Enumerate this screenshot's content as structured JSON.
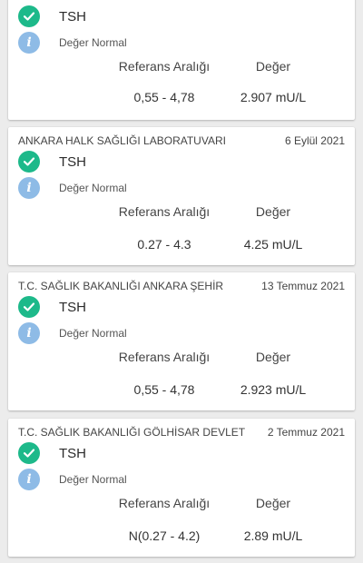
{
  "results": [
    {
      "lab": "",
      "date": "",
      "test": "TSH",
      "status": "Değer Normal",
      "range_label": "Referans Aralığı",
      "value_label": "Değer",
      "range": "0,55 - 4,78",
      "value": "2.907 mU/L"
    },
    {
      "lab": "ANKARA HALK SAĞLIĞI LABORATUVARI",
      "date": "6 Eylül 2021",
      "test": "TSH",
      "status": "Değer Normal",
      "range_label": "Referans Aralığı",
      "value_label": "Değer",
      "range": "0.27 - 4.3",
      "value": "4.25 mU/L"
    },
    {
      "lab": "T.C. SAĞLIK BAKANLIĞI ANKARA ŞEHİR",
      "date": "13 Temmuz 2021",
      "test": "TSH",
      "status": "Değer Normal",
      "range_label": "Referans Aralığı",
      "value_label": "Değer",
      "range": "0,55 - 4,78",
      "value": "2.923 mU/L"
    },
    {
      "lab": "T.C. SAĞLIK BAKANLIĞI GÖLHİSAR DEVLET",
      "date": "2 Temmuz 2021",
      "test": "TSH",
      "status": "Değer Normal",
      "range_label": "Referans Aralığı",
      "value_label": "Değer",
      "range": "N(0.27 - 4.2)",
      "value": "2.89 mU/L"
    }
  ],
  "colors": {
    "check": "#1db98a",
    "info": "#8ebbe6",
    "background": "#ececec",
    "card": "#ffffff"
  },
  "icons": {
    "status": "check-circle-icon",
    "info": "info-icon"
  }
}
